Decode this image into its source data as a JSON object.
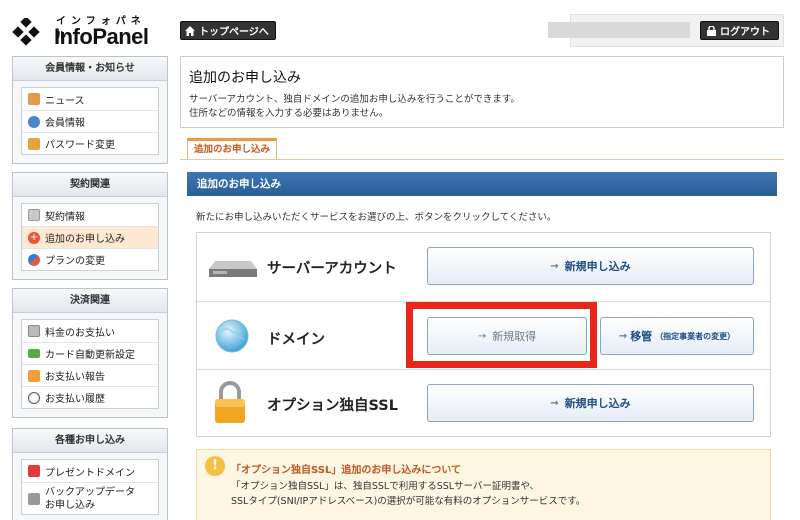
{
  "logo": {
    "kana": "インフォパネル",
    "name": "InfoPanel"
  },
  "header": {
    "top_page": "トップページへ",
    "logout": "ログアウト"
  },
  "sidebar": {
    "member": {
      "title": "会員情報・お知らせ",
      "items": [
        "ニュース",
        "会員情報",
        "パスワード変更"
      ]
    },
    "contract": {
      "title": "契約関連",
      "items": [
        "契約情報",
        "追加のお申し込み",
        "プランの変更"
      ]
    },
    "payment": {
      "title": "決済関連",
      "items": [
        "料金のお支払い",
        "カード自動更新設定",
        "お支払い報告",
        "お支払い履歴"
      ]
    },
    "apps": {
      "title": "各種お申し込み",
      "items": [
        "プレゼントドメイン",
        "バックアップデータ",
        "お申し込み"
      ]
    }
  },
  "page": {
    "title": "追加のお申し込み",
    "desc1": "サーバーアカウント、独自ドメインの追加お申し込みを行うことができます。",
    "desc2": "住所などの情報を入力する必要はありません。"
  },
  "tab": {
    "label": "追加のお申し込み"
  },
  "section": {
    "title": "追加のお申し込み",
    "instruction": "新たにお申し込みいただくサービスをお選びの上、ボタンをクリックしてください。"
  },
  "services": {
    "server": {
      "name": "サーバーアカウント",
      "button": "新規申し込み"
    },
    "domain": {
      "name": "ドメイン",
      "new_button": "新規取得",
      "transfer_button": "移管",
      "transfer_note": "（指定事業者の変更）"
    },
    "ssl": {
      "name": "オプション独自SSL",
      "button": "新規申し込み"
    }
  },
  "notice": {
    "title": "「オプション独自SSL」追加のお申し込みについて",
    "line1": "「オプション独自SSL」は、独自SSLで利用するSSLサーバー証明書や、",
    "line2": "SSLタイプ(SNI/IPアドレスベース)の選択が可能な有料のオプションサービスです。"
  },
  "colors": {
    "accent": "#2a5d96",
    "highlight": "#e8261a",
    "tab": "#f29a3a"
  }
}
